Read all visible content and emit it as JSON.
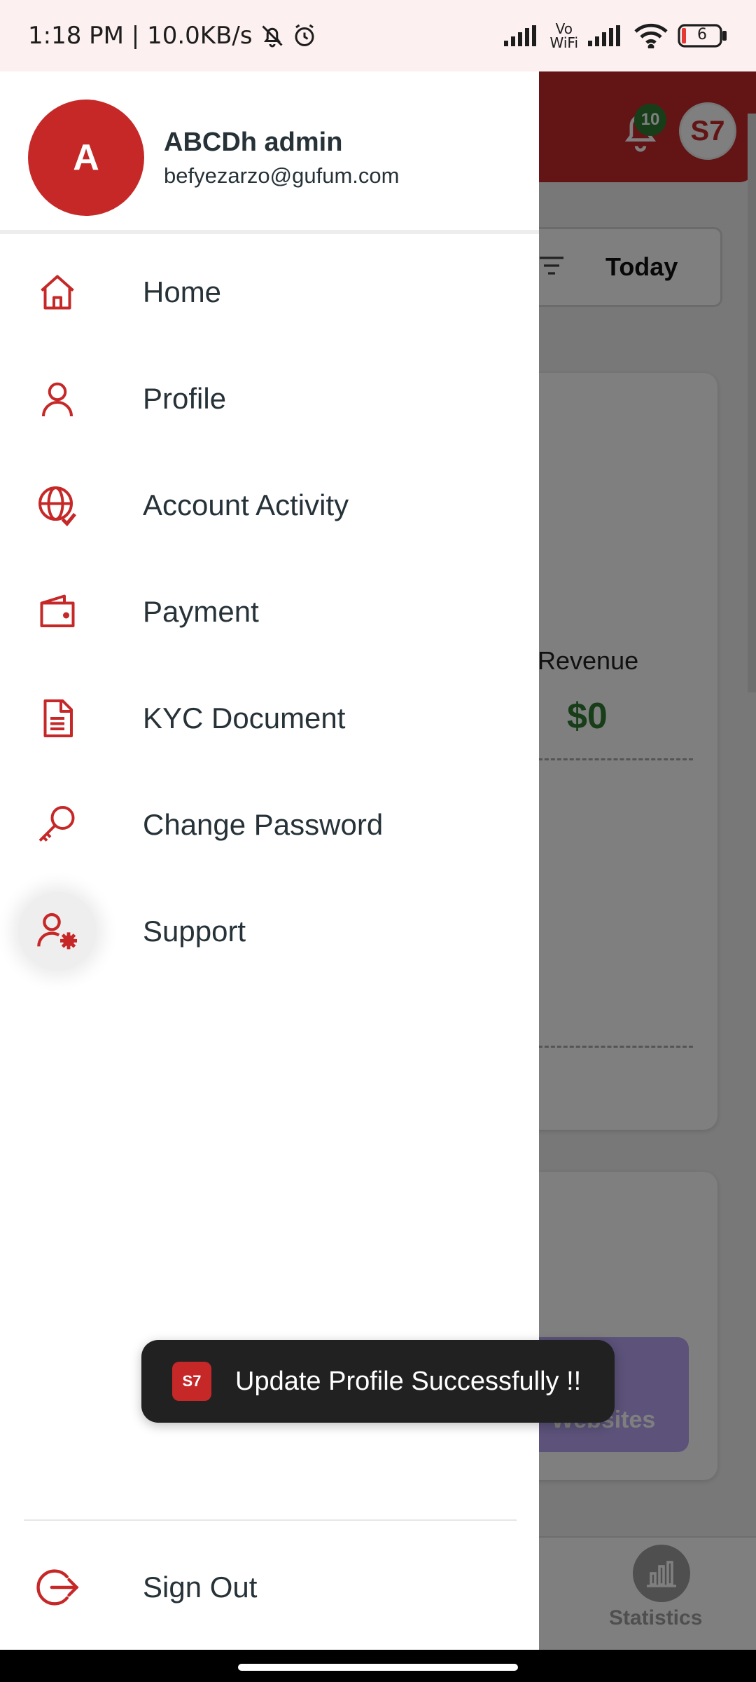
{
  "status_bar": {
    "time_speed": "1:18 PM | 10.0KB/s",
    "vowifi": "Vo\nWiFi",
    "battery": "6"
  },
  "drawer": {
    "avatar_letter": "A",
    "user_name": "ABCDh admin",
    "user_email": "befyezarzo@gufum.com",
    "menu": [
      {
        "label": "Home",
        "icon": "home-icon"
      },
      {
        "label": "Profile",
        "icon": "user-icon"
      },
      {
        "label": "Account Activity",
        "icon": "globe-check-icon"
      },
      {
        "label": "Payment",
        "icon": "wallet-icon"
      },
      {
        "label": "KYC Document",
        "icon": "document-icon"
      },
      {
        "label": "Change Password",
        "icon": "key-icon"
      },
      {
        "label": "Support",
        "icon": "user-gear-icon"
      }
    ],
    "sign_out": "Sign Out",
    "accent_color": "#c62828"
  },
  "toast": {
    "message": "Update Profile Successfully !!"
  },
  "background_app": {
    "notification_count": "10",
    "filter_label": "Today",
    "revenue_label": "Revenue",
    "revenue_value": "$0",
    "websites_label": "Websites",
    "statistics_label": "Statistics"
  }
}
